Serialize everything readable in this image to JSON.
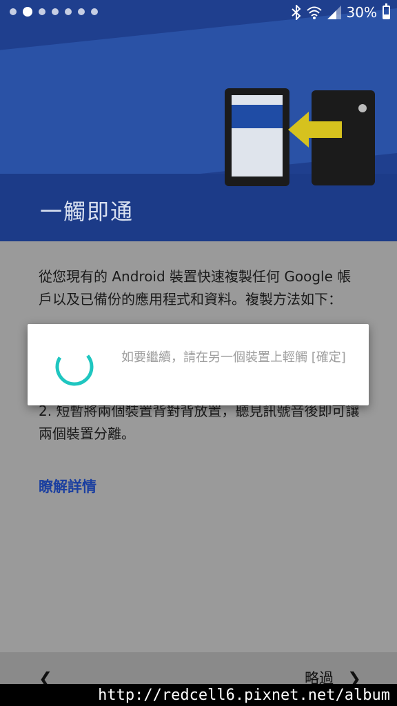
{
  "status_bar": {
    "battery_percent": "30%",
    "page_dots": 7,
    "active_dot": 1,
    "icons": [
      "bluetooth-icon",
      "wifi-icon",
      "signal-icon",
      "battery-icon"
    ]
  },
  "header": {
    "title": "一觸即通"
  },
  "content": {
    "intro": "從您現有的 Android 裝置快速複製任何 Google 帳戶以及已備份的應用程式和資料。複製方法如下：",
    "step2": "2. 短暫將兩個裝置背對背放置，聽見訊號音後即可讓兩個裝置分離。",
    "learn_more": "瞭解詳情"
  },
  "dialog": {
    "message": "如要繼續，請在另一個裝置上輕觸 [確定]"
  },
  "bottom_nav": {
    "back_icon": "chevron-left-icon",
    "skip_label": "略過",
    "skip_icon": "chevron-right-icon"
  },
  "watermark": "http://redcell6.pixnet.net/album",
  "colors": {
    "header_blue": "#1f3f8e",
    "link_blue": "#1b3fa0",
    "spinner_teal": "#1fc6c0",
    "arrow_yellow": "#d6c21e"
  }
}
